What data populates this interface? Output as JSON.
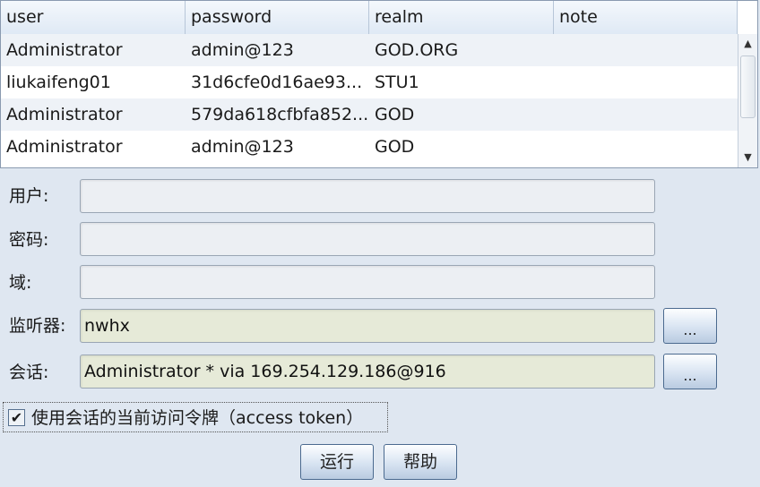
{
  "table": {
    "columns": [
      "user",
      "password",
      "realm",
      "note"
    ],
    "rows": [
      [
        "Administrator",
        "admin@123",
        "GOD.ORG",
        ""
      ],
      [
        "liukaifeng01",
        "31d6cfe0d16ae93...",
        "STU1",
        ""
      ],
      [
        "Administrator",
        "579da618cfbfa852...",
        "GOD",
        ""
      ],
      [
        "Administrator",
        "admin@123",
        "GOD",
        ""
      ]
    ]
  },
  "scrollbar": {
    "up_glyph": "▲",
    "down_glyph": "▼"
  },
  "form": {
    "user_label": "用户:",
    "user_value": "",
    "password_label": "密码:",
    "password_value": "",
    "realm_label": "域:",
    "realm_value": "",
    "listener_label": "监听器:",
    "listener_value": "nwhx",
    "listener_browse": "...",
    "session_label": "会话:",
    "session_value": "Administrator * via  169.254.129.186@916",
    "session_browse": "...",
    "use_token_label": "使用会话的当前访问令牌（access token）",
    "use_token_checked": true,
    "check_glyph": "✔"
  },
  "buttons": {
    "run": "运行",
    "help": "帮助"
  }
}
